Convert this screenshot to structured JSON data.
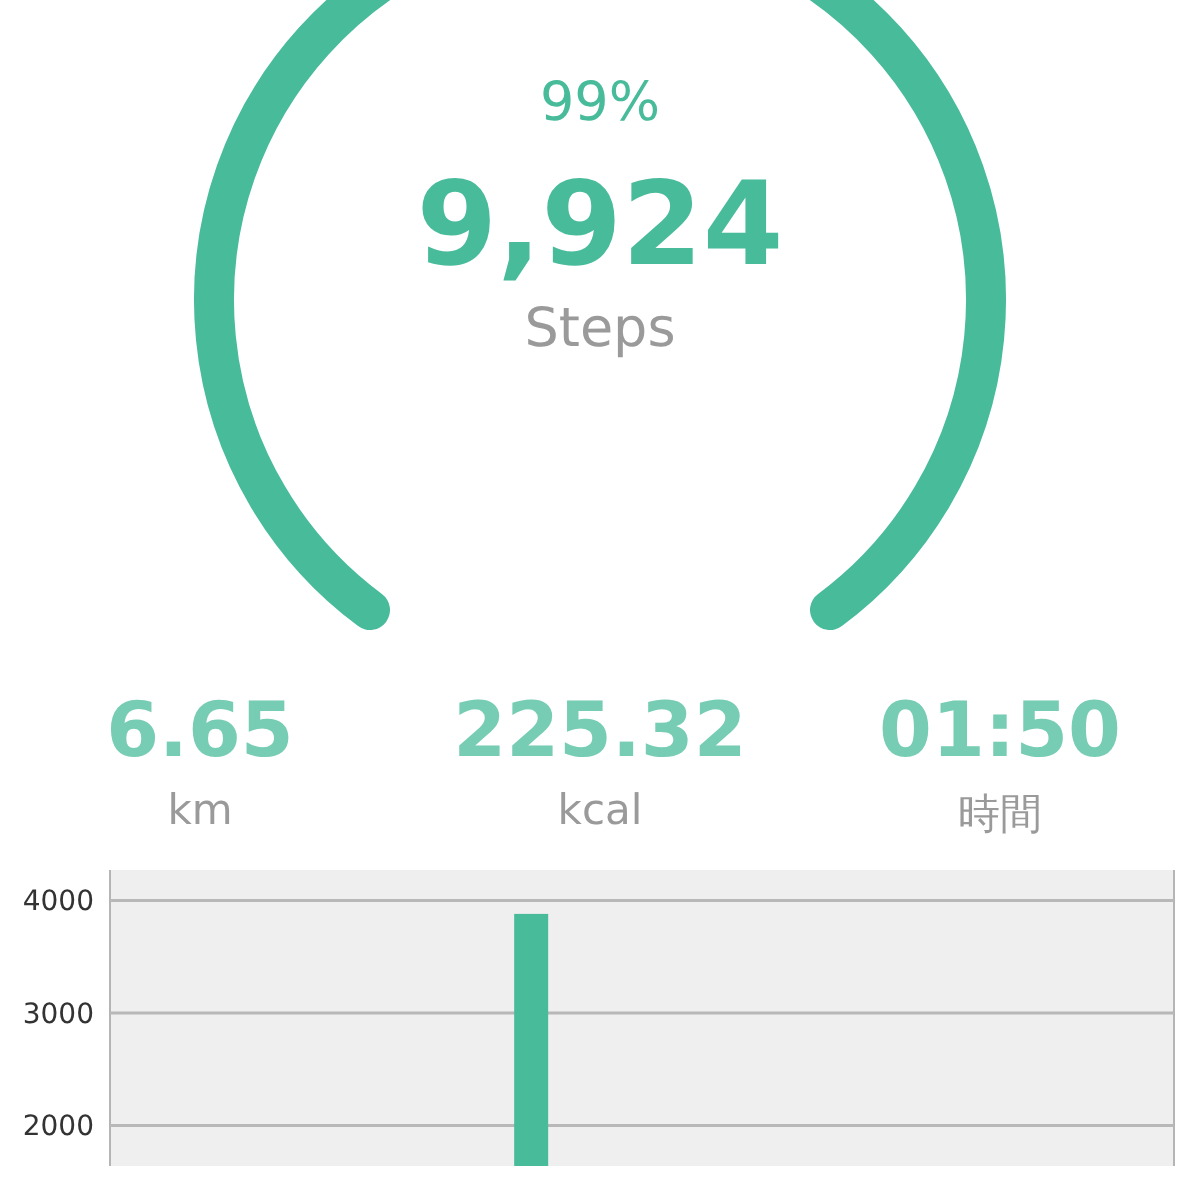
{
  "goal": {
    "percent": "99%",
    "steps": "9,924",
    "unit": "Steps"
  },
  "stats": [
    {
      "value": "6.65",
      "unit": "km"
    },
    {
      "value": "225.32",
      "unit": "kcal"
    },
    {
      "value": "01:50",
      "unit": "時間"
    }
  ],
  "chart": {
    "chart_data": {
      "type": "bar",
      "grid": true,
      "ylim": [
        1640,
        4270
      ],
      "yticks": [
        2000,
        3000,
        4000
      ],
      "values": [
        null,
        null,
        null,
        null,
        null,
        null,
        null,
        null,
        null,
        3880,
        null,
        null,
        null,
        null,
        null,
        null,
        null,
        null,
        null,
        null,
        null,
        null,
        null,
        null
      ]
    }
  }
}
